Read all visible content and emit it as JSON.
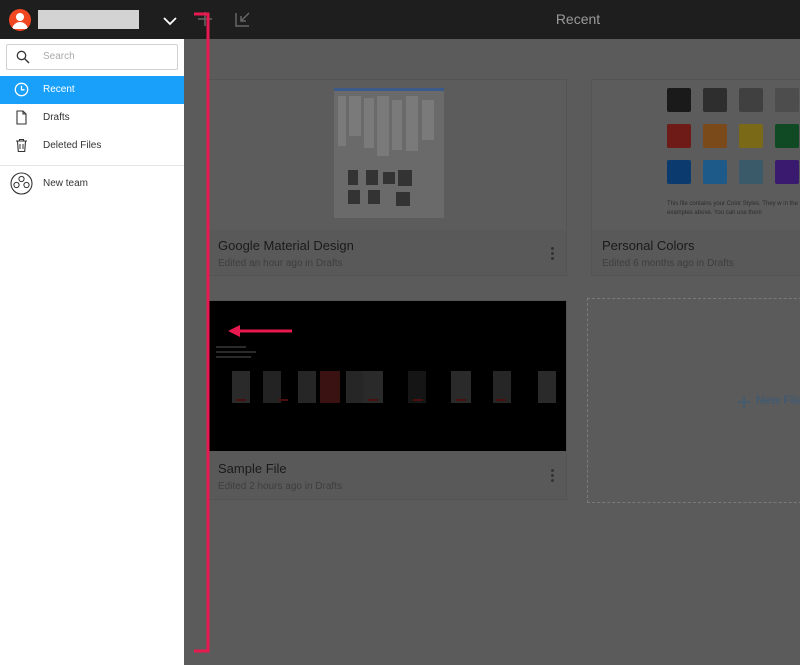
{
  "topbar": {
    "title": "Recent"
  },
  "sidebar": {
    "search_placeholder": "Search",
    "items": [
      {
        "label": "Recent",
        "icon": "clock-icon",
        "active": true
      },
      {
        "label": "Drafts",
        "icon": "file-icon",
        "active": false
      },
      {
        "label": "Deleted Files",
        "icon": "trash-icon",
        "active": false
      },
      {
        "label": "New team",
        "icon": "team-icon",
        "active": false
      }
    ]
  },
  "files": [
    {
      "title": "Google Material Design",
      "subtitle": "Edited an hour ago in Drafts"
    },
    {
      "title": "Personal Colors",
      "subtitle": "Edited 6 months ago in Drafts",
      "thumb_text": "This file contains your Color Styles. They w in the examples above. You can use them"
    },
    {
      "title": "Sample File",
      "subtitle": "Edited 2 hours ago in Drafts"
    }
  ],
  "new_file_label": "New File",
  "colors": {
    "accent": "#18a0fb",
    "annotation": "#e8194f",
    "swatches": [
      "#1a1a1a",
      "#2e2e2e",
      "#404040",
      "#4d4d4d",
      "#6e1a17",
      "#7a4a1a",
      "#7a6a17",
      "#0f4a24",
      "#0a3a6e",
      "#1d5a8a",
      "#3a5a6a",
      "#3a1a6e"
    ]
  }
}
